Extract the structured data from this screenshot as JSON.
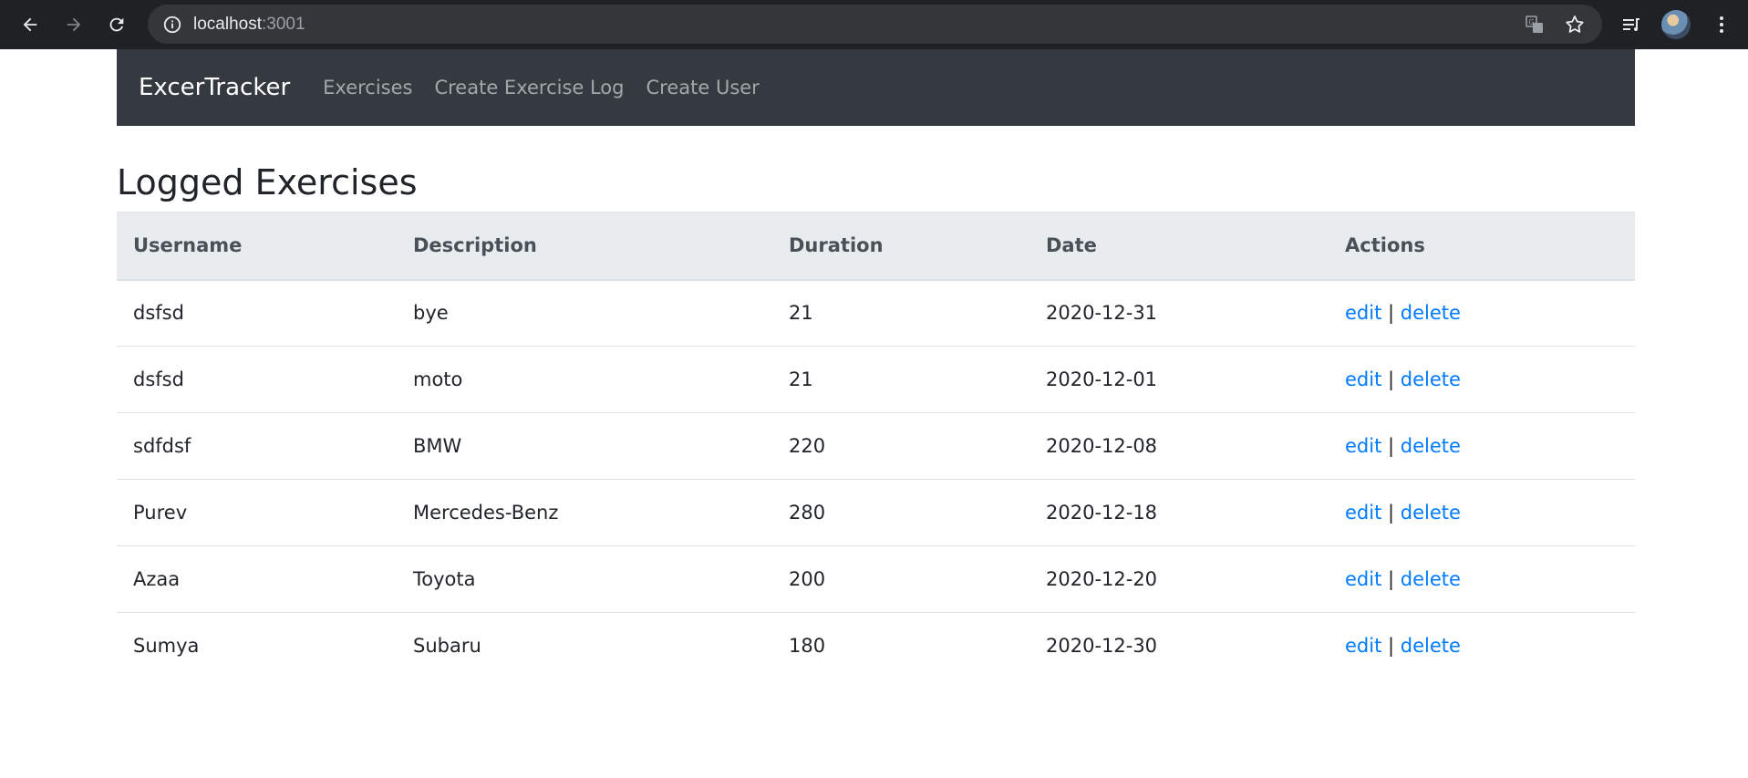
{
  "browser": {
    "url_host": "localhost",
    "url_port": ":3001",
    "icons": [
      "back-icon",
      "forward-icon",
      "reload-icon",
      "info-icon",
      "translate-icon",
      "star-icon",
      "reading-list-icon",
      "profile-avatar",
      "more-icon"
    ]
  },
  "navbar": {
    "brand": "ExcerTracker",
    "links": [
      "Exercises",
      "Create Exercise Log",
      "Create User"
    ]
  },
  "page": {
    "title": "Logged Exercises"
  },
  "table": {
    "headers": [
      "Username",
      "Description",
      "Duration",
      "Date",
      "Actions"
    ],
    "rows": [
      {
        "username": "dsfsd",
        "description": "bye",
        "duration": "21",
        "date": "2020-12-31",
        "edit": "edit",
        "sep": "|",
        "delete": "delete"
      },
      {
        "username": "dsfsd",
        "description": "moto",
        "duration": "21",
        "date": "2020-12-01",
        "edit": "edit",
        "sep": "|",
        "delete": "delete"
      },
      {
        "username": "sdfdsf",
        "description": "BMW",
        "duration": "220",
        "date": "2020-12-08",
        "edit": "edit",
        "sep": "|",
        "delete": "delete"
      },
      {
        "username": "Purev",
        "description": "Mercedes-Benz",
        "duration": "280",
        "date": "2020-12-18",
        "edit": "edit",
        "sep": "|",
        "delete": "delete"
      },
      {
        "username": "Azaa",
        "description": "Toyota",
        "duration": "200",
        "date": "2020-12-20",
        "edit": "edit",
        "sep": "|",
        "delete": "delete"
      },
      {
        "username": "Sumya",
        "description": "Subaru",
        "duration": "180",
        "date": "2020-12-30",
        "edit": "edit",
        "sep": "|",
        "delete": "delete"
      }
    ]
  },
  "colors": {
    "chrome_bg": "#202124",
    "navbar_bg": "#343a40",
    "link": "#007bff",
    "table_head_bg": "#e9ecef"
  }
}
